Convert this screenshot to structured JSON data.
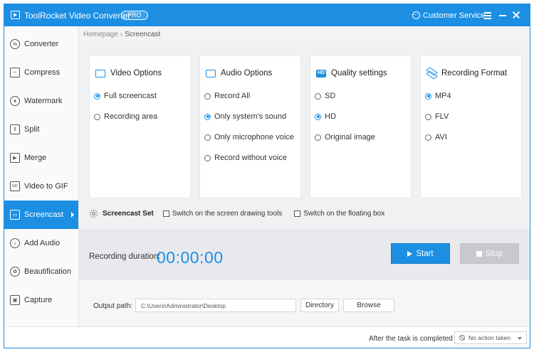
{
  "titlebar": {
    "title": "ToolRocket Video Converter",
    "badge": "PRO",
    "customer_service": "Customer Service",
    "accent": "#1c8fe3"
  },
  "sidebar": {
    "items": [
      {
        "label": "Converter",
        "icon": "converter-icon",
        "glyph": "⇆"
      },
      {
        "label": "Compress",
        "icon": "compress-icon",
        "glyph": "÷"
      },
      {
        "label": "Watermark",
        "icon": "watermark-icon",
        "glyph": "●"
      },
      {
        "label": "Split",
        "icon": "split-icon",
        "glyph": "‖"
      },
      {
        "label": "Merge",
        "icon": "merge-icon",
        "glyph": "▶"
      },
      {
        "label": "Video to GIF",
        "icon": "gif-icon",
        "glyph": "GIF"
      },
      {
        "label": "Screencast",
        "icon": "screencast-icon",
        "glyph": "▭",
        "active": true
      },
      {
        "label": "Add Audio",
        "icon": "add-audio-icon",
        "glyph": "♪"
      },
      {
        "label": "Beautification",
        "icon": "beautification-icon",
        "glyph": "✿"
      },
      {
        "label": "Capture",
        "icon": "capture-icon",
        "glyph": "▣"
      }
    ]
  },
  "breadcrumb": {
    "home": "Homepage",
    "separator": "›",
    "current": "Screencast"
  },
  "panels": [
    {
      "title": "Video Options",
      "icon": "video-options-icon",
      "options": [
        {
          "label": "Full screencast",
          "checked": true
        },
        {
          "label": "Recording area",
          "checked": false
        }
      ]
    },
    {
      "title": "Audio Options",
      "icon": "audio-options-icon",
      "options": [
        {
          "label": "Record All",
          "checked": false
        },
        {
          "label": "Only system's sound",
          "checked": true
        },
        {
          "label": "Only microphone voice",
          "checked": false
        },
        {
          "label": "Record without voice",
          "checked": false
        }
      ]
    },
    {
      "title": "Quality settings",
      "icon": "hd-icon",
      "options": [
        {
          "label": "SD",
          "checked": false
        },
        {
          "label": "HD",
          "checked": true
        },
        {
          "label": "Original image",
          "checked": false
        }
      ]
    },
    {
      "title": "Recording Format",
      "icon": "layers-icon",
      "options": [
        {
          "label": "MP4",
          "checked": true
        },
        {
          "label": "FLV",
          "checked": false
        },
        {
          "label": "AVI",
          "checked": false
        }
      ]
    }
  ],
  "screencast_set": {
    "label": "Screencast Set",
    "drawing_tools": "Switch on the screen drawing tools",
    "floating_box": "Switch on the floating box"
  },
  "recording": {
    "label": "Recording duration:",
    "value": "00:00:00",
    "start": "Start",
    "stop": "Stop"
  },
  "output": {
    "label": "Output path:",
    "path": "C:\\Users\\Administrator\\Desktop",
    "directory": "Directory",
    "browse": "Browse"
  },
  "status": {
    "after_label": "After the task is completed",
    "after_value": "No action taken"
  }
}
